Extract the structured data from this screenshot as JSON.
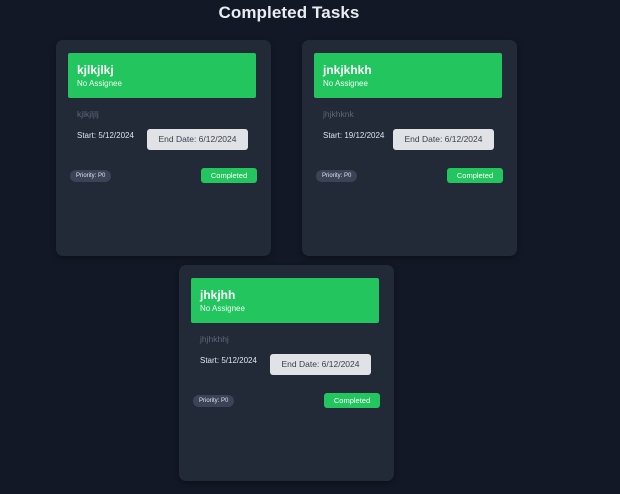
{
  "page": {
    "title": "Completed Tasks"
  },
  "tasks": [
    {
      "title": "kjlkjlkj",
      "assignee": "No Assignee",
      "description": "kjlkjljlj",
      "start": "Start: 5/12/2024",
      "end_date": "End Date: 6/12/2024",
      "priority": "Priority: P0",
      "status": "Completed"
    },
    {
      "title": "jnkjkhkh",
      "assignee": "No Assignee",
      "description": "jhjkhknk",
      "start": "Start: 19/12/2024",
      "end_date": "End Date: 6/12/2024",
      "priority": "Priority: P0",
      "status": "Completed"
    },
    {
      "title": "jhkjhh",
      "assignee": "No Assignee",
      "description": "jhjhkhhj",
      "start": "Start: 5/12/2024",
      "end_date": "End Date: 6/12/2024",
      "priority": "Priority: P0",
      "status": "Completed"
    }
  ],
  "colors": {
    "background": "#131826",
    "card": "#222a38",
    "header_green": "#22c55e",
    "end_date_bg": "#e0e2e6",
    "priority_bg": "#3a4456"
  }
}
